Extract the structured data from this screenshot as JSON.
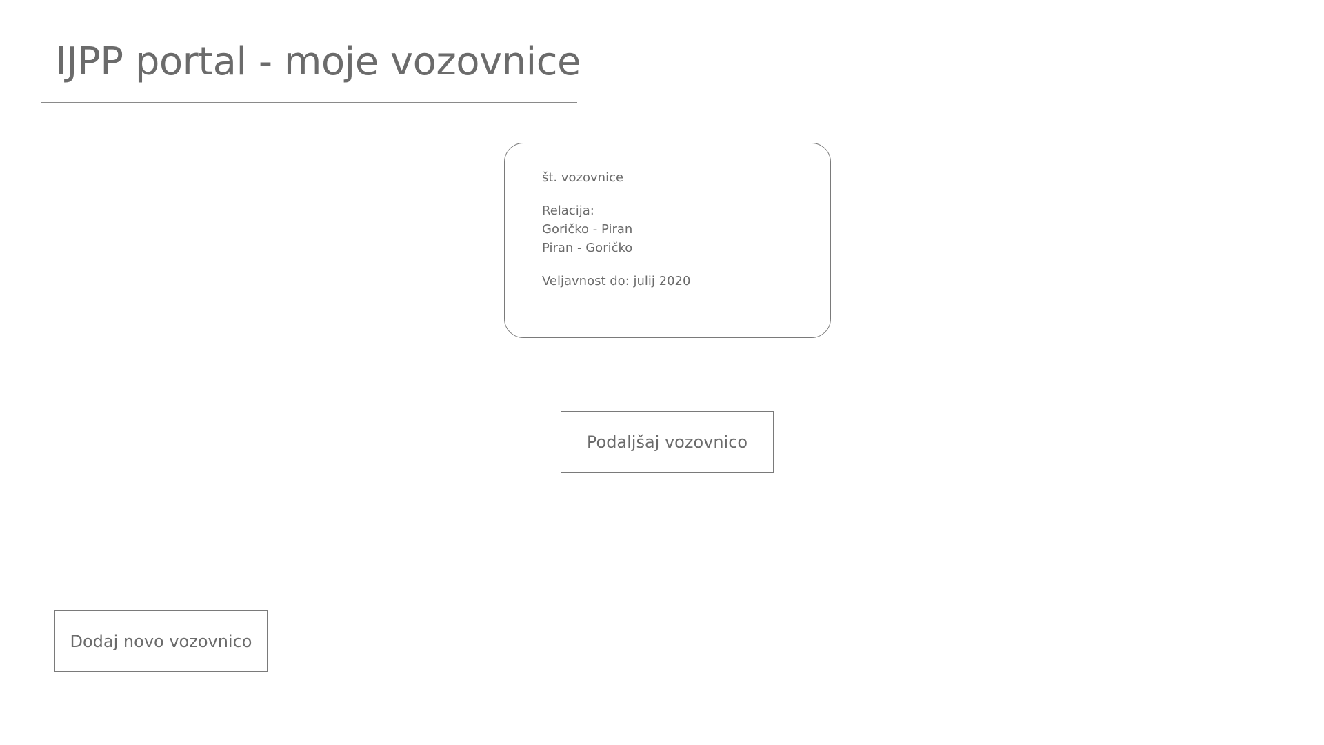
{
  "header": {
    "title": "IJPP portal - moje vozovnice"
  },
  "ticket": {
    "number_label": "št. vozovnice",
    "relation_label": "Relacija:",
    "relations": [
      "Goričko - Piran",
      "Piran - Goričko"
    ],
    "validity": "Veljavnost do: julij 2020"
  },
  "actions": {
    "extend_label": "Podaljšaj vozovnico",
    "add_label": "Dodaj novo vozovnico"
  },
  "colors": {
    "text": "#6b6b6b",
    "border": "#7a7a7a",
    "background": "#ffffff"
  }
}
